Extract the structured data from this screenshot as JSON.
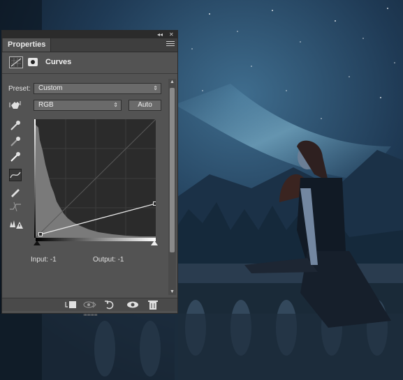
{
  "panel": {
    "tab_label": "Properties",
    "title": "Curves",
    "preset_label": "Preset:",
    "preset_value": "Custom",
    "channel_value": "RGB",
    "auto_label": "Auto",
    "input_label": "Input:",
    "input_value": "-1",
    "output_label": "Output:",
    "output_value": "-1",
    "collapse_glyph": "◂◂",
    "close_glyph": "✕"
  },
  "tools": [
    "hand-adjust-icon",
    "black-point-eyedropper-icon",
    "gray-point-eyedropper-icon",
    "white-point-eyedropper-icon",
    "curve-edit-icon",
    "pencil-draw-icon",
    "smooth-curve-icon",
    "clipping-warning-icon"
  ],
  "footer_icons": [
    "clip-to-layer-icon",
    "view-previous-state-icon",
    "reset-icon",
    "visibility-eye-icon",
    "trash-icon"
  ],
  "colors": {
    "panel_bg": "#535353",
    "accent_curve": "#e8e8e8"
  }
}
